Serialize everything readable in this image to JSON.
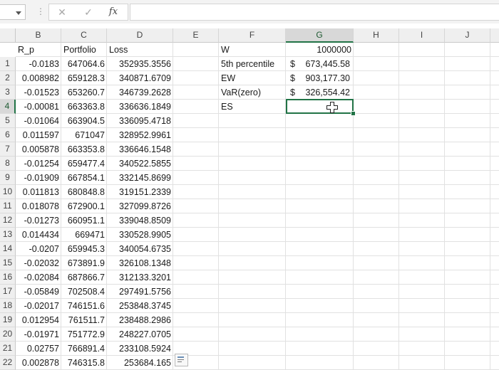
{
  "formula_bar": {
    "name_box": "",
    "cancel_icon": "✕",
    "enter_icon": "✓",
    "fx_icon": "fx",
    "formula": ""
  },
  "colors": {
    "selection": "#217346",
    "header_bg": "#efefef"
  },
  "columns": [
    "B",
    "C",
    "D",
    "E",
    "F",
    "G",
    "H",
    "I",
    "J"
  ],
  "row_numbers": [
    "1",
    "2",
    "3",
    "4",
    "5",
    "6",
    "7",
    "8",
    "9",
    "10",
    "11",
    "12",
    "13",
    "14",
    "15",
    "16",
    "17",
    "18",
    "19",
    "20",
    "21",
    "22"
  ],
  "headers": {
    "b": "R_p",
    "c": "Portfolio",
    "d": "Loss"
  },
  "rows": [
    [
      "-0.0183",
      "647064.6",
      "352935.3556"
    ],
    [
      "0.008982",
      "659128.3",
      "340871.6709"
    ],
    [
      "-0.01523",
      "653260.7",
      "346739.2628"
    ],
    [
      "-0.00081",
      "663363.8",
      "336636.1849"
    ],
    [
      "-0.01064",
      "663904.5",
      "336095.4718"
    ],
    [
      "0.011597",
      "671047",
      "328952.9961"
    ],
    [
      "0.005878",
      "663353.8",
      "336646.1548"
    ],
    [
      "-0.01254",
      "659477.4",
      "340522.5855"
    ],
    [
      "-0.01909",
      "667854.1",
      "332145.8699"
    ],
    [
      "0.011813",
      "680848.8",
      "319151.2339"
    ],
    [
      "0.018078",
      "672900.1",
      "327099.8726"
    ],
    [
      "-0.01273",
      "660951.1",
      "339048.8509"
    ],
    [
      "0.014434",
      "669471",
      "330528.9905"
    ],
    [
      "-0.0207",
      "659945.3",
      "340054.6735"
    ],
    [
      "-0.02032",
      "673891.9",
      "326108.1348"
    ],
    [
      "-0.02084",
      "687866.7",
      "312133.3201"
    ],
    [
      "-0.05849",
      "702508.4",
      "297491.5756"
    ],
    [
      "-0.02017",
      "746151.6",
      "253848.3745"
    ],
    [
      "0.012954",
      "761511.7",
      "238488.2986"
    ],
    [
      "-0.01971",
      "751772.9",
      "248227.0705"
    ],
    [
      "0.02757",
      "766891.4",
      "233108.5924"
    ],
    [
      "0.002878",
      "746315.8",
      "253684.165"
    ]
  ],
  "summary": {
    "w_label": "W",
    "w_value": "1000000",
    "p5_label": "5th percentile",
    "p5_symbol": "$",
    "p5_value": "673,445.58",
    "ew_label": "EW",
    "ew_symbol": "$",
    "ew_value": "903,177.30",
    "var_label": "VaR(zero)",
    "var_symbol": "$",
    "var_value": "326,554.42",
    "es_label": "ES",
    "es_value": ""
  }
}
